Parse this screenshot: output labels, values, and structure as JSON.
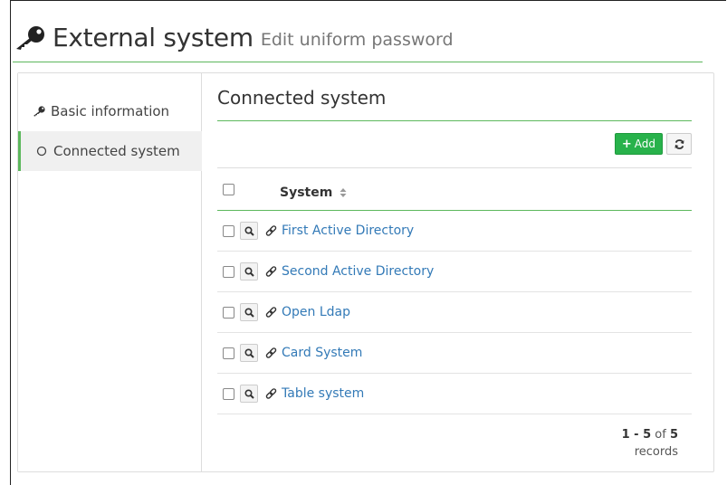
{
  "header": {
    "title": "External system",
    "subtitle": "Edit uniform password",
    "icon": "key-icon"
  },
  "sidebar": {
    "items": [
      {
        "label": "Basic information",
        "icon": "key-icon",
        "active": false
      },
      {
        "label": "Connected system",
        "icon": "circle-icon",
        "active": true
      }
    ]
  },
  "main": {
    "title": "Connected system",
    "toolbar": {
      "add_label": "Add",
      "refresh_icon": "refresh-icon"
    },
    "table": {
      "column_header": "System",
      "rows": [
        {
          "name": "First Active Directory"
        },
        {
          "name": "Second Active Directory"
        },
        {
          "name": "Open Ldap"
        },
        {
          "name": "Card System"
        },
        {
          "name": "Table system"
        }
      ]
    },
    "pager": {
      "range": "1 - 5",
      "of": "of",
      "total": "5",
      "suffix": "records"
    }
  },
  "colors": {
    "accent": "#5cb85c",
    "add_button": "#28b24b",
    "link": "#337ab7"
  }
}
